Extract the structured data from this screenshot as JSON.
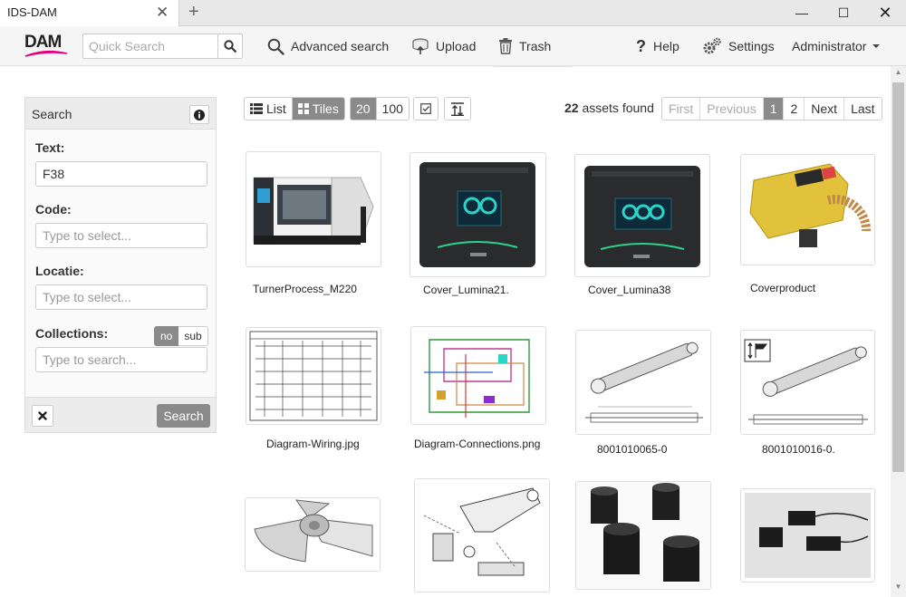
{
  "browser": {
    "tab_title": "IDS-DAM",
    "tab_close": "✕",
    "new_tab": "+",
    "minimize": "—",
    "maximize": "☐",
    "close": "✕"
  },
  "header": {
    "logo": "DAM",
    "quick_search_placeholder": "Quick Search",
    "nav": {
      "advanced_search": "Advanced search",
      "upload": "Upload",
      "trash": "Trash",
      "help": "Help",
      "settings": "Settings",
      "user": "Administrator"
    }
  },
  "search_panel": {
    "title": "Search",
    "text_label": "Text:",
    "text_value": "F38",
    "code_label": "Code:",
    "code_placeholder": "Type to select...",
    "locatie_label": "Locatie:",
    "locatie_placeholder": "Type to select...",
    "collections_label": "Collections:",
    "toggle_no": "no",
    "toggle_sub": "sub",
    "collections_placeholder": "Type to search...",
    "search_button": "Search"
  },
  "toolbar": {
    "list": "List",
    "tiles": "Tiles",
    "size_20": "20",
    "size_100": "100"
  },
  "results": {
    "count": "22",
    "count_suffix": " assets found"
  },
  "pager": {
    "first": "First",
    "previous": "Previous",
    "page_1": "1",
    "page_2": "2",
    "next": "Next",
    "last": "Last"
  },
  "tiles": [
    {
      "caption": "TurnerProcess_M220"
    },
    {
      "caption": "Cover_Lumina21."
    },
    {
      "caption": "Cover_Lumina38"
    },
    {
      "caption": "Coverproduct"
    },
    {
      "caption": "Diagram-Wiring.jpg"
    },
    {
      "caption": "Diagram-Connections.png"
    },
    {
      "caption": "8001010065-0"
    },
    {
      "caption": "8001010016-0."
    }
  ],
  "colors": {
    "active": "#8a8a8a",
    "logo_swoosh": "#e4007c",
    "lumina_screen": "#2bd4c8"
  }
}
